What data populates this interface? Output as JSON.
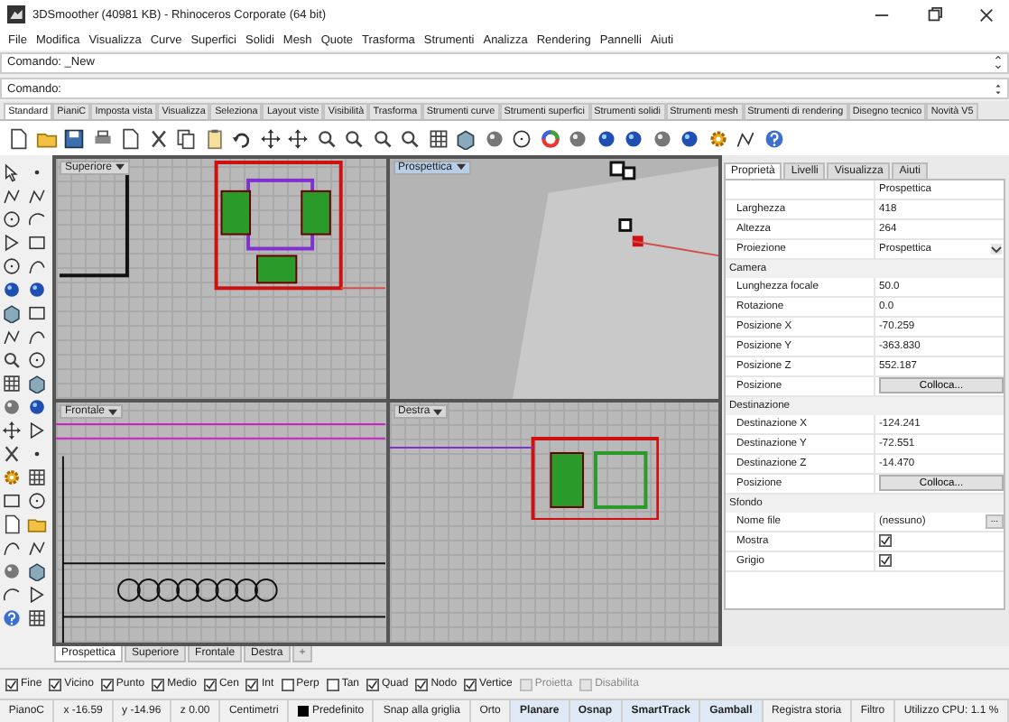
{
  "window": {
    "title": "3DSmoother (40981 KB) - Rhinoceros Corporate (64 bit)"
  },
  "menu": [
    "File",
    "Modifica",
    "Visualizza",
    "Curve",
    "Superfici",
    "Solidi",
    "Mesh",
    "Quote",
    "Trasforma",
    "Strumenti",
    "Analizza",
    "Rendering",
    "Pannelli",
    "Aiuti"
  ],
  "command": {
    "history": "Comando: _New",
    "prompt": "Comando:"
  },
  "toolbar_tabs": [
    {
      "label": "Standard",
      "selected": true
    },
    {
      "label": "PianiC",
      "selected": false
    },
    {
      "label": "Imposta vista",
      "selected": false
    },
    {
      "label": "Visualizza",
      "selected": false
    },
    {
      "label": "Seleziona",
      "selected": false
    },
    {
      "label": "Layout viste",
      "selected": false
    },
    {
      "label": "Visibilità",
      "selected": false
    },
    {
      "label": "Trasforma",
      "selected": false
    },
    {
      "label": "Strumenti curve",
      "selected": false
    },
    {
      "label": "Strumenti superfici",
      "selected": false
    },
    {
      "label": "Strumenti solidi",
      "selected": false
    },
    {
      "label": "Strumenti mesh",
      "selected": false
    },
    {
      "label": "Strumenti di rendering",
      "selected": false
    },
    {
      "label": "Disegno tecnico",
      "selected": false
    },
    {
      "label": "Novità V5",
      "selected": false
    }
  ],
  "viewports": [
    {
      "label": "Superiore",
      "active": false,
      "kind": "top"
    },
    {
      "label": "Prospettica",
      "active": true,
      "kind": "perspective"
    },
    {
      "label": "Frontale",
      "active": false,
      "kind": "front"
    },
    {
      "label": "Destra",
      "active": false,
      "kind": "right"
    }
  ],
  "viewport_tabs": [
    {
      "label": "Prospettica",
      "selected": true
    },
    {
      "label": "Superiore",
      "selected": false
    },
    {
      "label": "Frontale",
      "selected": false
    },
    {
      "label": "Destra",
      "selected": false
    }
  ],
  "add_tab": "+",
  "panel": {
    "tabs": [
      {
        "label": "Proprietà",
        "selected": true
      },
      {
        "label": "Livelli",
        "selected": false
      },
      {
        "label": "Visualizza",
        "selected": false
      },
      {
        "label": "Aiuti",
        "selected": false
      }
    ],
    "sections": [
      {
        "rows": [
          {
            "kind": "text",
            "value": "Prospettica"
          },
          {
            "kind": "text",
            "label": "Larghezza",
            "value": "418"
          },
          {
            "kind": "text",
            "label": "Altezza",
            "value": "264"
          },
          {
            "kind": "dropdown",
            "label": "Proiezione",
            "value": "Prospettica"
          }
        ]
      },
      {
        "title": "Camera",
        "rows": [
          {
            "kind": "text",
            "label": "Lunghezza focale",
            "value": "50.0"
          },
          {
            "kind": "text",
            "label": "Rotazione",
            "value": "0.0"
          },
          {
            "kind": "text",
            "label": "Posizione X",
            "value": "-70.259"
          },
          {
            "kind": "text",
            "label": "Posizione Y",
            "value": "-363.830"
          },
          {
            "kind": "text",
            "label": "Posizione Z",
            "value": "552.187"
          },
          {
            "kind": "button",
            "label": "Posizione",
            "value": "Colloca..."
          }
        ]
      },
      {
        "title": "Destinazione",
        "rows": [
          {
            "kind": "text",
            "label": "Destinazione X",
            "value": "-124.241"
          },
          {
            "kind": "text",
            "label": "Destinazione Y",
            "value": "-72.551"
          },
          {
            "kind": "text",
            "label": "Destinazione Z",
            "value": "-14.470"
          },
          {
            "kind": "button",
            "label": "Posizione",
            "value": "Colloca..."
          }
        ]
      },
      {
        "title": "Sfondo",
        "rows": [
          {
            "kind": "file",
            "label": "Nome file",
            "value": "(nessuno)",
            "button": "..."
          },
          {
            "kind": "checkbox",
            "label": "Mostra",
            "checked": true
          },
          {
            "kind": "checkbox",
            "label": "Grigio",
            "checked": true
          }
        ]
      }
    ]
  },
  "osnaps": [
    {
      "label": "Fine",
      "checked": true,
      "disabled": false
    },
    {
      "label": "Vicino",
      "checked": true,
      "disabled": false
    },
    {
      "label": "Punto",
      "checked": true,
      "disabled": false
    },
    {
      "label": "Medio",
      "checked": true,
      "disabled": false
    },
    {
      "label": "Cen",
      "checked": true,
      "disabled": false
    },
    {
      "label": "Int",
      "checked": true,
      "disabled": false
    },
    {
      "label": "Perp",
      "checked": false,
      "disabled": false
    },
    {
      "label": "Tan",
      "checked": false,
      "disabled": false
    },
    {
      "label": "Quad",
      "checked": true,
      "disabled": false
    },
    {
      "label": "Nodo",
      "checked": true,
      "disabled": false
    },
    {
      "label": "Vertice",
      "checked": true,
      "disabled": false
    },
    {
      "label": "Proietta",
      "checked": false,
      "disabled": true
    },
    {
      "label": "Disabilita",
      "checked": false,
      "disabled": true
    }
  ],
  "status_bar": [
    {
      "kind": "plain",
      "text": "PianoC"
    },
    {
      "kind": "plain",
      "text": "x -16.59"
    },
    {
      "kind": "plain",
      "text": "y -14.96"
    },
    {
      "kind": "plain",
      "text": "z 0.00"
    },
    {
      "kind": "plain",
      "text": "Centimetri"
    },
    {
      "kind": "layer",
      "text": "Predefinito",
      "color": "#000000"
    },
    {
      "kind": "toggle",
      "text": "Snap alla griglia",
      "on": false
    },
    {
      "kind": "toggle",
      "text": "Orto",
      "on": false
    },
    {
      "kind": "toggle",
      "text": "Planare",
      "on": true
    },
    {
      "kind": "toggle",
      "text": "Osnap",
      "on": true
    },
    {
      "kind": "toggle",
      "text": "SmartTrack",
      "on": true
    },
    {
      "kind": "toggle",
      "text": "Gamball",
      "on": true
    },
    {
      "kind": "toggle",
      "text": "Registra storia",
      "on": false
    },
    {
      "kind": "toggle",
      "text": "Filtro",
      "on": false
    },
    {
      "kind": "plain",
      "text": "Utilizzo CPU: 1.1 %"
    }
  ]
}
